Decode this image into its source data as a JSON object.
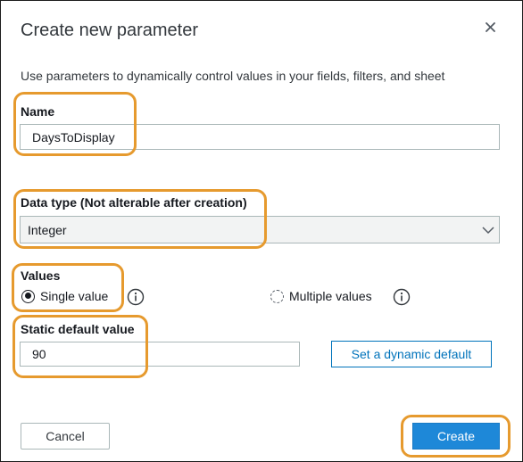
{
  "dialog": {
    "title": "Create new parameter",
    "description": "Use parameters to dynamically control values in your fields, filters, and sheet",
    "close_icon": "close-icon"
  },
  "name": {
    "label": "Name",
    "value": "DaysToDisplay"
  },
  "data_type": {
    "label": "Data type (Not alterable after creation)",
    "selected": "Integer",
    "icon": "chevron-down-icon"
  },
  "values": {
    "label": "Values",
    "options": [
      {
        "label": "Single value",
        "checked": true
      },
      {
        "label": "Multiple values",
        "checked": false
      }
    ],
    "info_icon": "info-icon"
  },
  "static_default": {
    "label": "Static default value",
    "value": "90"
  },
  "buttons": {
    "dynamic_default": "Set a dynamic default",
    "cancel": "Cancel",
    "create": "Create"
  },
  "colors": {
    "highlight": "#e69a2e",
    "primary": "#1e88d8",
    "link": "#0073bb",
    "border": "#aab7b8"
  }
}
